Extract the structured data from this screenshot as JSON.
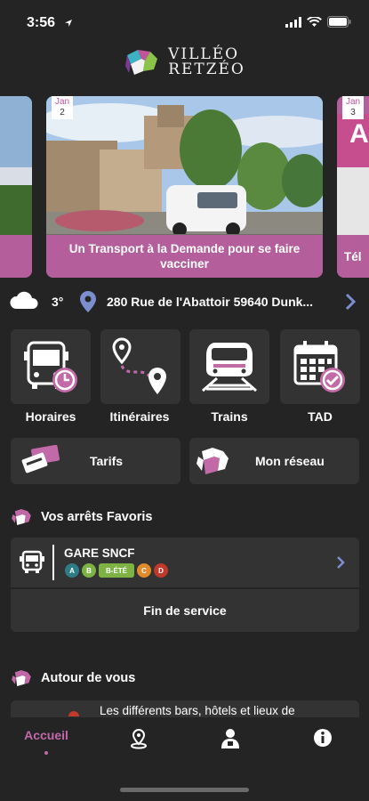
{
  "status_bar": {
    "time": "3:56"
  },
  "brand": {
    "line1": "VILLÉO",
    "line2": "RETZÉO"
  },
  "carousel": {
    "main": {
      "month": "Jan",
      "day": "2",
      "caption": "Un Transport à la Demande pour se faire vacciner"
    },
    "right": {
      "month": "Jan",
      "day": "3",
      "caption_partial": "Tél",
      "banner_letter": "A"
    }
  },
  "weather": {
    "temperature": "3°",
    "address": "280 Rue de l'Abattoir 59640 Dunk..."
  },
  "quick_actions": [
    {
      "label": "Horaires",
      "icon": "bus-clock-icon"
    },
    {
      "label": "Itinéraires",
      "icon": "route-icon"
    },
    {
      "label": "Trains",
      "icon": "train-icon"
    },
    {
      "label": "TAD",
      "icon": "calendar-check-icon"
    }
  ],
  "wide_buttons": {
    "tarifs": "Tarifs",
    "reseau": "Mon réseau"
  },
  "favorites": {
    "title": "Vos arrêts Favoris",
    "stop_name": "GARE SNCF",
    "lines": [
      {
        "label": "A",
        "color": "#2e7d86"
      },
      {
        "label": "B",
        "color": "#7cb342"
      },
      {
        "label": "B-ÉTÉ",
        "color": "#7cb342"
      },
      {
        "label": "C",
        "color": "#e08a2b"
      },
      {
        "label": "D",
        "color": "#c0392b"
      }
    ],
    "service_status": "Fin de service"
  },
  "around": {
    "title": "Autour de vous",
    "preview": "Les différents bars, hôtels et lieux de"
  },
  "tabs": {
    "home": "Accueil"
  },
  "colors": {
    "accent": "#c26aa8",
    "background": "#242424",
    "card": "#333333"
  }
}
